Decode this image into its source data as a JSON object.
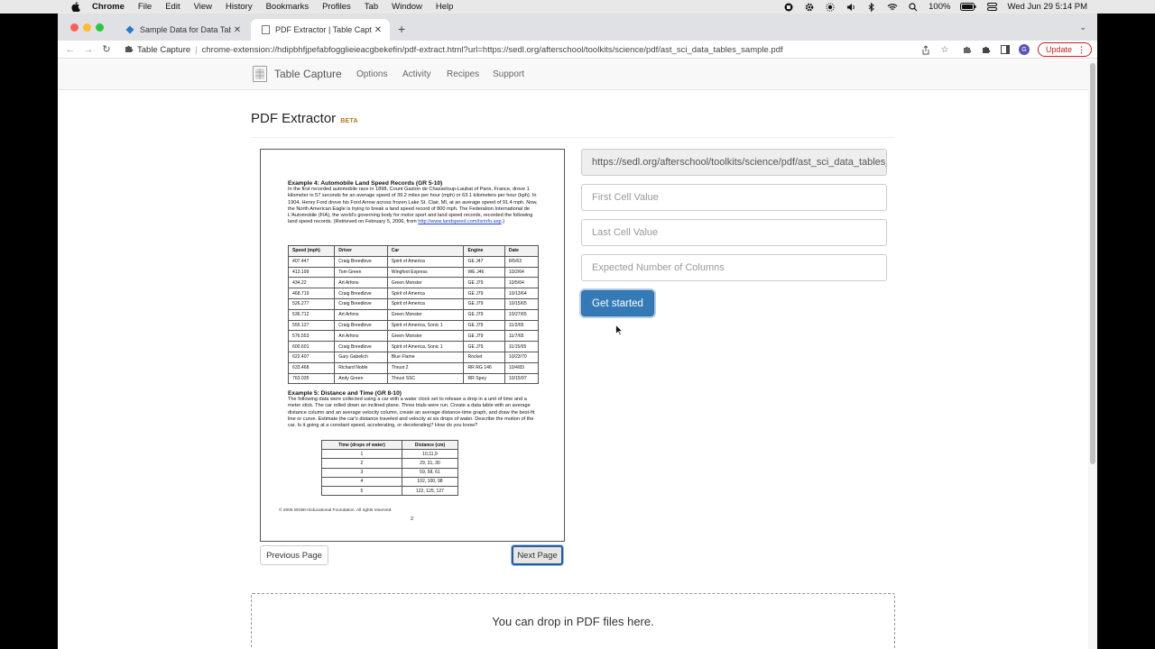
{
  "menubar": {
    "app": "Chrome",
    "items": [
      "File",
      "Edit",
      "View",
      "History",
      "Bookmarks",
      "Profiles",
      "Tab",
      "Window",
      "Help"
    ],
    "battery": "100%",
    "clock": "Wed Jun 29  5:14 PM"
  },
  "tabs": [
    {
      "title": "Sample Data for Data Tables",
      "active": false
    },
    {
      "title": "PDF Extractor | Table Capture",
      "active": true
    }
  ],
  "toolbar": {
    "extension_name": "Table Capture",
    "url": "chrome-extension://hdipbhfjpefabfogglieieacgbekefin/pdf-extract.html?url=https://sedl.org/afterschool/toolkits/science/pdf/ast_sci_data_tables_sample.pdf",
    "update_label": "Update",
    "avatar_letter": "G"
  },
  "nav": {
    "brand": "Table Capture",
    "links": [
      "Options",
      "Activity",
      "Recipes",
      "Support"
    ]
  },
  "header": {
    "title": "PDF Extractor",
    "badge": "BETA"
  },
  "pdf": {
    "ex4_heading": "Example 4: Automobile Land Speed Records (GR 5-10)",
    "ex4_text": "In the first recorded automobile race in 1898, Count Gaston de Chasseloup-Laubat of Paris, France, drove 1 kilometer in 57 seconds for an average speed of 39.2 miles per hour (mph) or 63.1 kilometers per hour (kph). In 1904, Henry Ford drove his Ford Arrow across frozen Lake St. Clair, MI, at an average speed of 91.4 mph. Now, the North American Eagle is trying to break a land speed record of 800 mph. The Federation International de L'Automobile (FIA), the world's governing body for motor sport and land speed records, recorded the following land speed records. (Retrieved on February 5, 2006, from",
    "ex4_link": "http://www.landspeed.com/lsrinfo.asp",
    "ex4_text_end": ".)",
    "table1": {
      "headers": [
        "Speed (mph)",
        "Driver",
        "Car",
        "Engine",
        "Date"
      ],
      "rows": [
        [
          "407.447",
          "Craig Breedlove",
          "Spirit of America",
          "GE J47",
          "8/5/63"
        ],
        [
          "413.199",
          "Tom Green",
          "Wingfoot Express",
          "WE J46",
          "10/2/64"
        ],
        [
          "434.22",
          "Art Arfons",
          "Green Monster",
          "GE J79",
          "10/5/64"
        ],
        [
          "468.719",
          "Craig Breedlove",
          "Spirit of America",
          "GE J79",
          "10/13/64"
        ],
        [
          "526.277",
          "Craig Breedlove",
          "Spirit of America",
          "GE J79",
          "10/15/65"
        ],
        [
          "536.712",
          "Art Arfons",
          "Green Monster",
          "GE J79",
          "10/27/65"
        ],
        [
          "555.127",
          "Craig Breedlove",
          "Spirit of America, Sonic 1",
          "GE J79",
          "11/2/65"
        ],
        [
          "576.553",
          "Art Arfons",
          "Green Monster",
          "GE J79",
          "11/7/65"
        ],
        [
          "600.601",
          "Craig Breedlove",
          "Spirit of America, Sonic 1",
          "GE J79",
          "11/15/65"
        ],
        [
          "622.407",
          "Gary Gabelich",
          "Blue Flame",
          "Rocket",
          "10/23/70"
        ],
        [
          "633.468",
          "Richard Noble",
          "Thrust 2",
          "RR RG 146",
          "10/4/83"
        ],
        [
          "763.035",
          "Andy Green",
          "Thrust SSC",
          "RR Spey",
          "10/15/97"
        ]
      ]
    },
    "ex5_heading": "Example 5: Distance and Time (GR 8-10)",
    "ex5_text": "The following data were collected using a car with a water clock set to release a drop in a unit of time and a meter stick. The car rolled down an inclined plane. Three trials were run. Create a data table with an average distance column and an average velocity column, create an average distance-time graph, and draw the best-fit line or curve. Estimate the car's distance traveled and velocity at six drops of water. Describe the motion of the car. Is it going at a constant speed, accelerating, or decelerating? How do you know?",
    "table2": {
      "headers": [
        "Time (drops of water)",
        "Distance (cm)"
      ],
      "rows": [
        [
          "1",
          "10,11,9"
        ],
        [
          "2",
          "29, 31, 30"
        ],
        [
          "3",
          "59, 58, 61"
        ],
        [
          "4",
          "102, 100, 98"
        ],
        [
          "5",
          "122, 125, 127"
        ]
      ]
    },
    "footer": "© 2006 WGBH Educational Foundation. All rights reserved.",
    "page_number": "2"
  },
  "pager": {
    "prev_label": "Previous Page",
    "next_label": "Next Page"
  },
  "form": {
    "url_value": "https://sedl.org/afterschool/toolkits/science/pdf/ast_sci_data_tables_sample.pdf",
    "first_cell_placeholder": "First Cell Value",
    "last_cell_placeholder": "Last Cell Value",
    "columns_placeholder": "Expected Number of Columns",
    "start_label": "Get started"
  },
  "dropzone": {
    "text": "You can drop in PDF files here."
  },
  "colors": {
    "primary": "#337ab7",
    "beta_badge": "#b8731c",
    "update_red": "#c5221f"
  }
}
